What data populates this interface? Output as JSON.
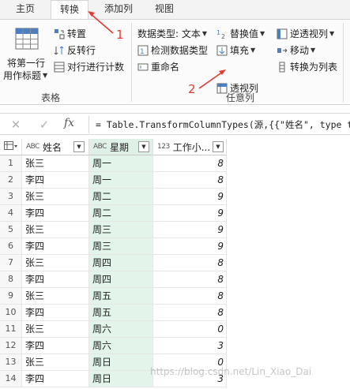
{
  "tabs": [
    "主页",
    "转换",
    "添加列",
    "视图"
  ],
  "active_tab": "转换",
  "table_group": {
    "label": "表格",
    "first_row_header": [
      "将第一行",
      "用作标题"
    ],
    "transpose": "转置",
    "reverse_rows": "反转行",
    "count_rows": "对行进行计数"
  },
  "anycolumn_group": {
    "label": "任意列",
    "data_type": "数据类型: 文本",
    "detect_type": "检测数据类型",
    "rename": "重命名",
    "replace_values": "替换值",
    "fill": "填充",
    "pivot": "透视列",
    "unpivot": "逆透视列",
    "move": "移动",
    "to_list": "转换为列表"
  },
  "annotations": [
    "1",
    "2"
  ],
  "formula": {
    "cancel": "✕",
    "confirm": "✓",
    "fx": "fx",
    "text": "= Table.TransformColumnTypes(源,{{\"姓名\", type tex"
  },
  "columns": [
    {
      "type": "ABC",
      "name": "姓名"
    },
    {
      "type": "ABC",
      "name": "星期"
    },
    {
      "type": "123",
      "name": "工作小..."
    }
  ],
  "rows": [
    {
      "n": "1",
      "name": "张三",
      "day": "周一",
      "hours": "8"
    },
    {
      "n": "2",
      "name": "李四",
      "day": "周一",
      "hours": "8"
    },
    {
      "n": "3",
      "name": "张三",
      "day": "周二",
      "hours": "9"
    },
    {
      "n": "4",
      "name": "李四",
      "day": "周二",
      "hours": "9"
    },
    {
      "n": "5",
      "name": "张三",
      "day": "周三",
      "hours": "9"
    },
    {
      "n": "6",
      "name": "李四",
      "day": "周三",
      "hours": "9"
    },
    {
      "n": "7",
      "name": "张三",
      "day": "周四",
      "hours": "8"
    },
    {
      "n": "8",
      "name": "李四",
      "day": "周四",
      "hours": "8"
    },
    {
      "n": "9",
      "name": "张三",
      "day": "周五",
      "hours": "8"
    },
    {
      "n": "10",
      "name": "李四",
      "day": "周五",
      "hours": "8"
    },
    {
      "n": "11",
      "name": "张三",
      "day": "周六",
      "hours": "0"
    },
    {
      "n": "12",
      "name": "李四",
      "day": "周六",
      "hours": "3"
    },
    {
      "n": "13",
      "name": "张三",
      "day": "周日",
      "hours": "0"
    },
    {
      "n": "14",
      "name": "李四",
      "day": "周日",
      "hours": "3"
    }
  ],
  "watermark": "https://blog.csdn.net/Lin_Xiao_Dai",
  "colors": {
    "annotation": "#e53935",
    "selected_column": "#e3f4ea",
    "accent": "#217346"
  }
}
